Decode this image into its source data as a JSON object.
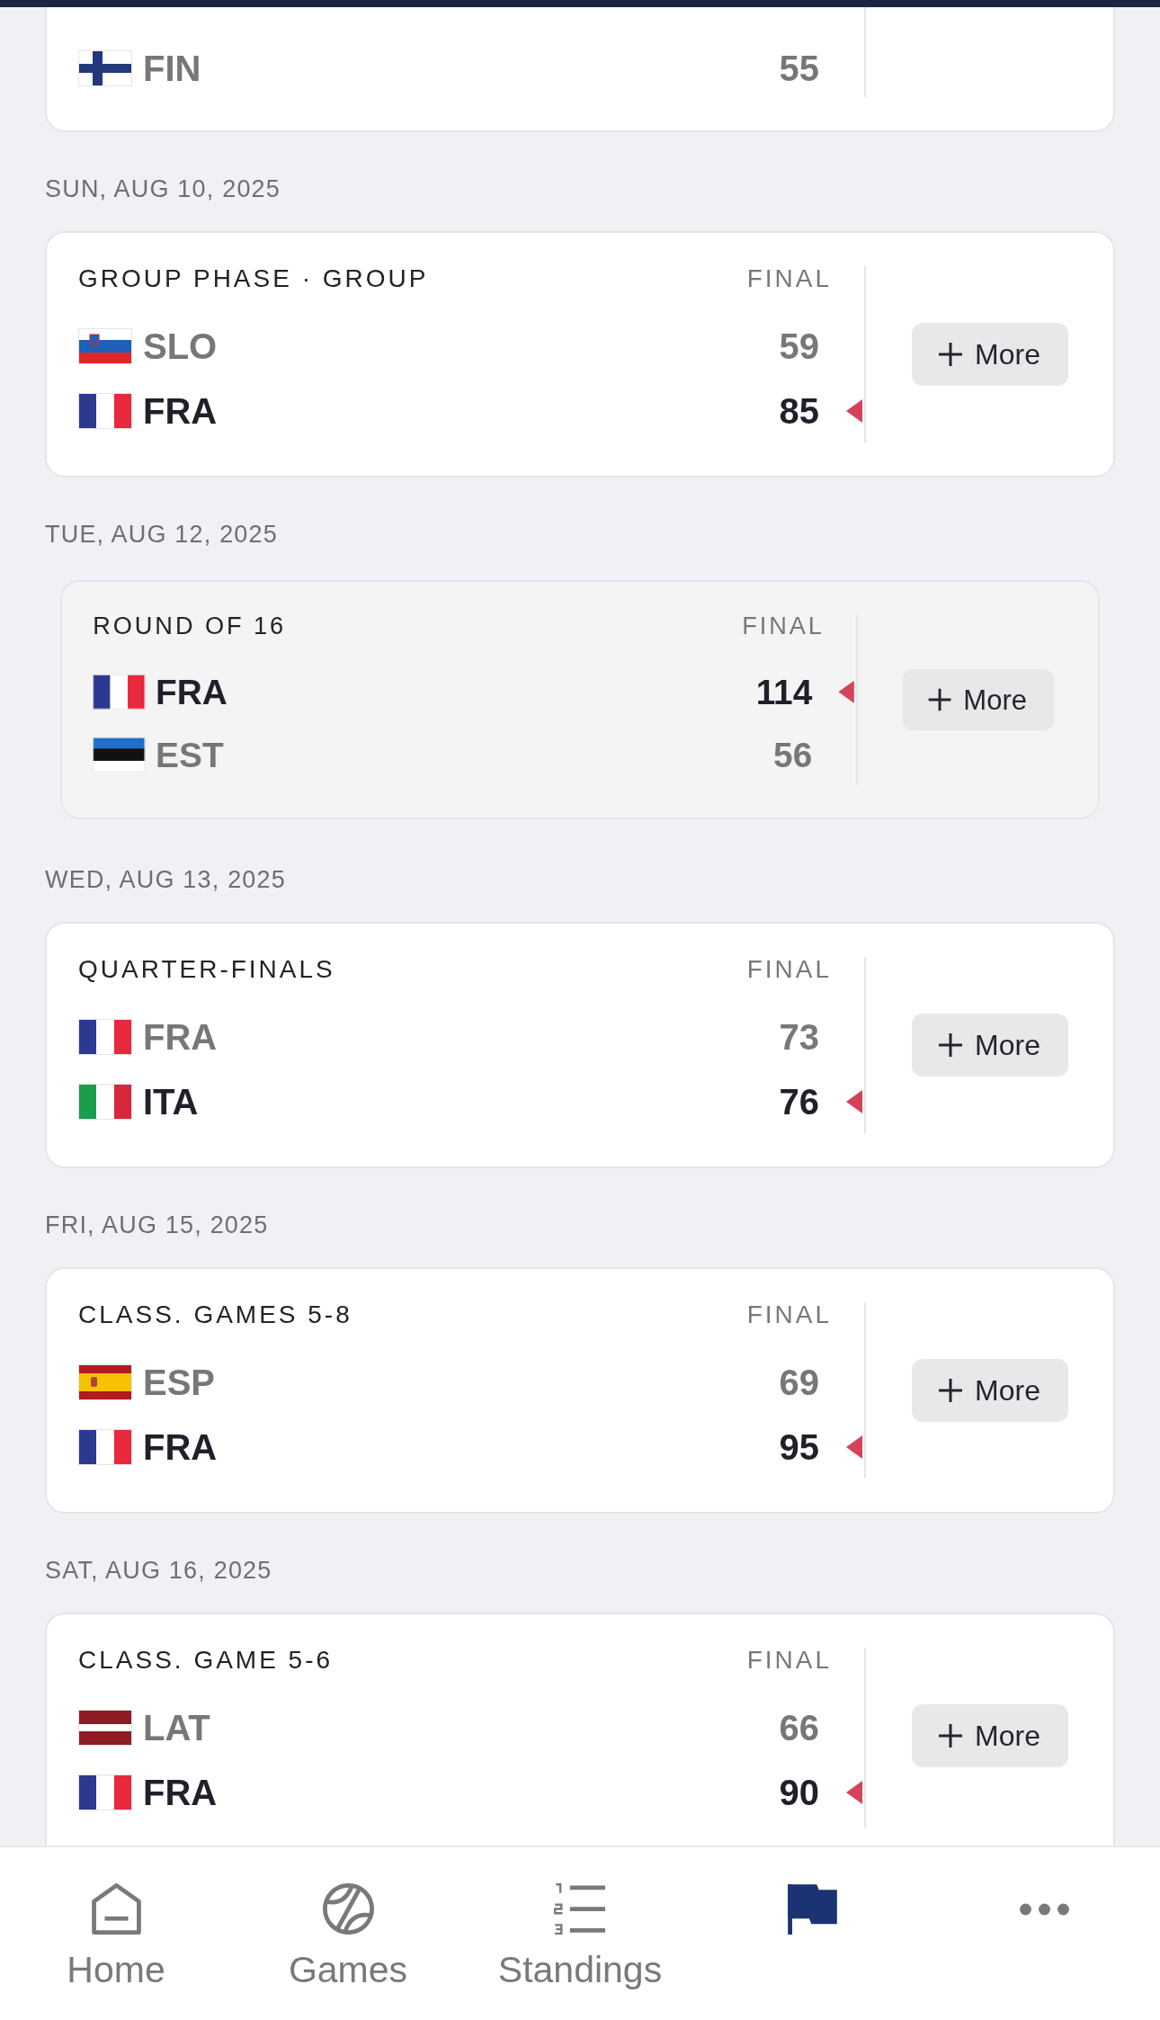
{
  "sections": [
    {
      "game": {
        "kind": "cut_top",
        "pressed": false,
        "teams": [
          {
            "code": "FIN",
            "kind": "finland",
            "score": "55",
            "winner": false
          }
        ]
      }
    },
    {
      "date": "SUN, AUG 10, 2025",
      "game": {
        "kind": "full",
        "pressed": false,
        "round": "GROUP PHASE · GROUP",
        "status": "FINAL",
        "teams": [
          {
            "code": "SLO",
            "kind": "slovenia",
            "score": "59",
            "winner": false
          },
          {
            "code": "FRA",
            "kind": "france",
            "score": "85",
            "winner": true
          }
        ],
        "more_button": "More"
      }
    },
    {
      "date": "TUE, AUG 12, 2025",
      "game": {
        "kind": "full",
        "pressed": true,
        "round": "ROUND OF 16",
        "status": "FINAL",
        "teams": [
          {
            "code": "FRA",
            "kind": "france",
            "score": "114",
            "winner": true
          },
          {
            "code": "EST",
            "kind": "estonia",
            "score": "56",
            "winner": false
          }
        ],
        "more_button": "More"
      }
    },
    {
      "date": "WED, AUG 13, 2025",
      "game": {
        "kind": "full",
        "pressed": false,
        "round": "QUARTER-FINALS",
        "status": "FINAL",
        "teams": [
          {
            "code": "FRA",
            "kind": "france",
            "score": "73",
            "winner": false
          },
          {
            "code": "ITA",
            "kind": "italy",
            "score": "76",
            "winner": true
          }
        ],
        "more_button": "More"
      }
    },
    {
      "date": "FRI, AUG 15, 2025",
      "game": {
        "kind": "full",
        "pressed": false,
        "round": "CLASS. GAMES 5-8",
        "status": "FINAL",
        "teams": [
          {
            "code": "ESP",
            "kind": "spain",
            "score": "69",
            "winner": false
          },
          {
            "code": "FRA",
            "kind": "france",
            "score": "95",
            "winner": true
          }
        ],
        "more_button": "More"
      }
    },
    {
      "date": "SAT, AUG 16, 2025",
      "game": {
        "kind": "cut_bottom",
        "pressed": false,
        "round": "CLASS. GAME 5-6",
        "status": "FINAL",
        "teams": [
          {
            "code": "LAT",
            "kind": "latvia",
            "score": "66",
            "winner": false
          },
          {
            "code": "FRA",
            "kind": "france",
            "score": "90",
            "winner": true
          }
        ],
        "more_button": "More"
      }
    }
  ],
  "bottom_nav": [
    {
      "label": "Home",
      "selected": false
    },
    {
      "label": "Games",
      "selected": false
    },
    {
      "label": "Standings",
      "selected": false
    },
    {
      "selected": true
    },
    {
      "selected": false
    }
  ]
}
